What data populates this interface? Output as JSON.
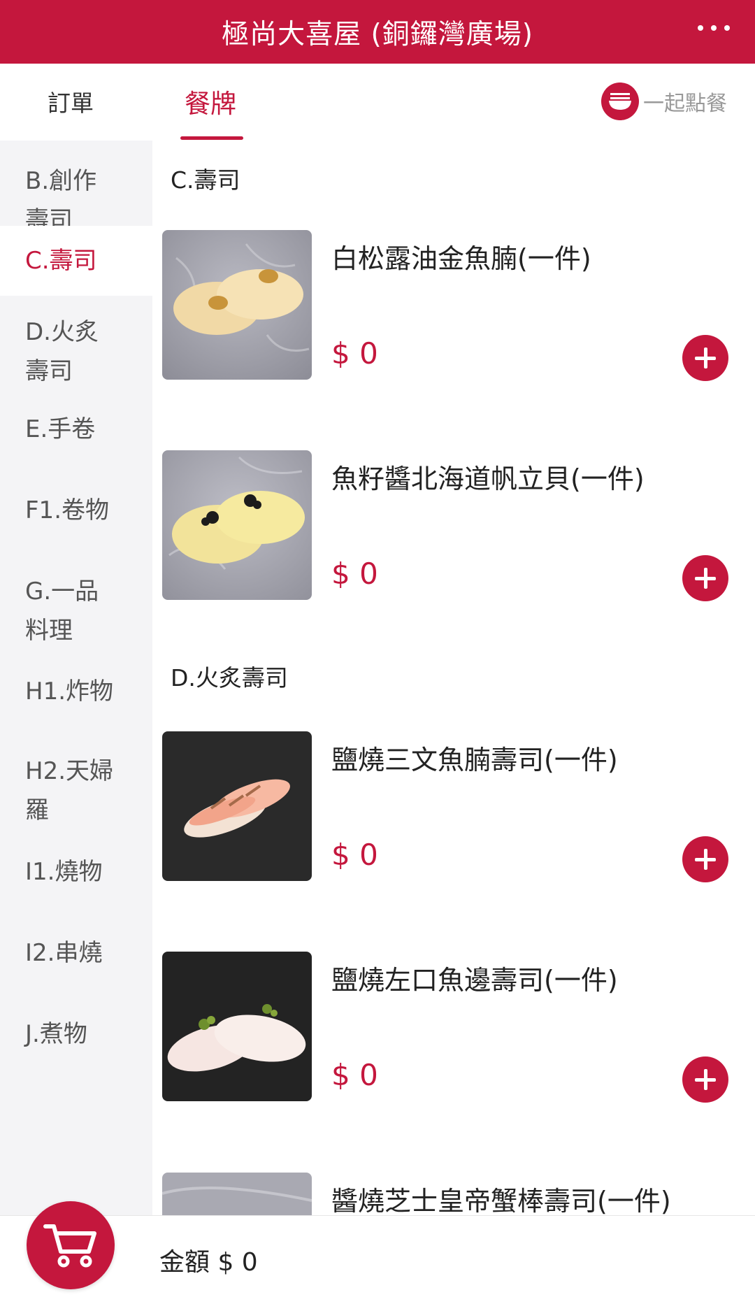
{
  "header": {
    "title": "極尚大喜屋 (銅鑼灣廣場)"
  },
  "tabs": {
    "orders": "訂單",
    "menu": "餐牌",
    "group_order": "一起點餐"
  },
  "sidebar": {
    "items": [
      {
        "line1": "B.創作",
        "line2": "壽司"
      },
      {
        "line1": "C.壽司"
      },
      {
        "line1": "D.火炙",
        "line2": "壽司"
      },
      {
        "line1": "E.手卷"
      },
      {
        "line1": "F1.卷物"
      },
      {
        "line1": "G.一品",
        "line2": "料理"
      },
      {
        "line1": "H1.炸物"
      },
      {
        "line1": "H2.天婦",
        "line2": "羅"
      },
      {
        "line1": "I1.燒物"
      },
      {
        "line1": "I2.串燒"
      },
      {
        "line1": "J.煮物"
      }
    ],
    "active_index": 1
  },
  "sections": [
    {
      "title": "C.壽司",
      "items": [
        {
          "name": "白松露油金魚腩(一件)",
          "price": "$ 0"
        },
        {
          "name": "魚籽醬北海道帆立貝(一件)",
          "price": "$ 0"
        }
      ]
    },
    {
      "title": "D.火炙壽司",
      "items": [
        {
          "name": "鹽燒三文魚腩壽司(一件)",
          "price": "$ 0"
        },
        {
          "name": "鹽燒左口魚邊壽司(一件)",
          "price": "$ 0"
        },
        {
          "name": "醬燒芝士皇帝蟹棒壽司(一件)",
          "price": ""
        }
      ]
    }
  ],
  "footer": {
    "total_label": "金額 $ 0"
  },
  "colors": {
    "brand": "#c4173d",
    "sidebar_bg": "#f4f4f6"
  },
  "icons": {
    "menu": "more-dots-icon",
    "group": "bowl-icon",
    "cart": "cart-icon",
    "add": "plus-icon"
  }
}
